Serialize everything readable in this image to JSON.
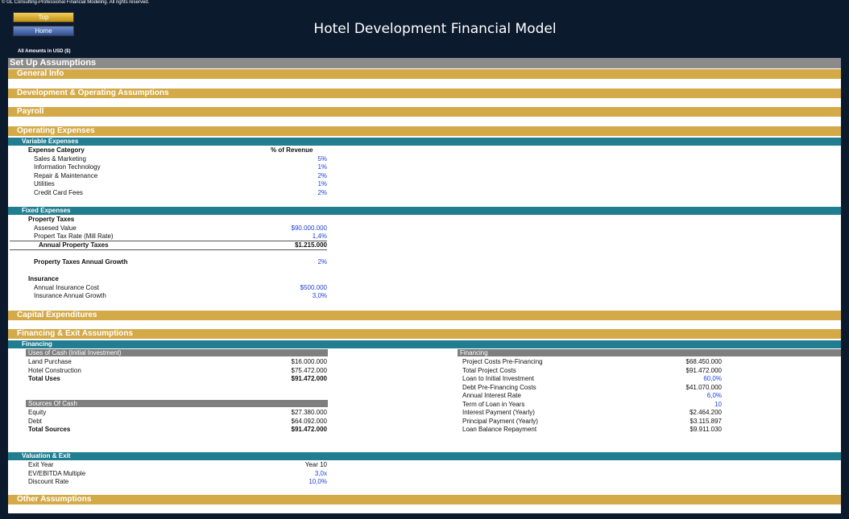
{
  "header": {
    "copyright": "© GL Consulting-Professional Financial Modeling. All rights reserved.",
    "top_button": "Top",
    "home_button": "Home",
    "title": "Hotel Development Financial Model",
    "currency_note": "All Amounts in  USD ($)"
  },
  "sections": {
    "setup": "Set Up Assumptions",
    "general_info": "General Info",
    "dev_operating": "Development & Operating Assumptions",
    "payroll": "Payroll",
    "operating_expenses": "Operating Expenses",
    "capital_expenditures": "Capital Expenditures",
    "financing_exit": "Financing & Exit Assumptions",
    "other": "Other Assumptions"
  },
  "variable_expenses": {
    "title": "Variable Expenses",
    "col_category": "Expense Category",
    "col_pct": "% of Revenue",
    "items": [
      {
        "label": "Sales & Marketing",
        "value": "5%"
      },
      {
        "label": "Information Technology",
        "value": "1%"
      },
      {
        "label": "Repair & Maintenance",
        "value": "2%"
      },
      {
        "label": "Utilities",
        "value": "1%"
      },
      {
        "label": "Credit Card Fees",
        "value": "2%"
      }
    ]
  },
  "fixed_expenses": {
    "title": "Fixed Expenses",
    "property_taxes": "Property Taxes",
    "assessed_value_label": "Assesed Value",
    "assessed_value": "$90.000.000",
    "tax_rate_label": "Propert Tax Rate (Mill Rate)",
    "tax_rate": "1,4%",
    "annual_tax_label": "Annual Property Taxes",
    "annual_tax": "$1.215.000",
    "tax_growth_label": "Property Taxes Annual Growth",
    "tax_growth": "2%",
    "insurance": "Insurance",
    "insurance_cost_label": "Annual Insurance Cost",
    "insurance_cost": "$500.000",
    "insurance_growth_label": "Insurance Annual Growth",
    "insurance_growth": "3,0%"
  },
  "financing": {
    "title": "Financing",
    "uses": {
      "header": "Uses of Cash (Initial Investment)",
      "rows": [
        {
          "label": "Land Purchase",
          "value": "$16.000.000",
          "bold": false
        },
        {
          "label": "Hotel Construction",
          "value": "$75.472.000",
          "bold": false
        },
        {
          "label": "Total Uses",
          "value": "$91.472.000",
          "bold": true
        }
      ]
    },
    "sources": {
      "header": "Sources Of Cash",
      "rows": [
        {
          "label": "Equity",
          "value": "$27.380.000",
          "bold": false
        },
        {
          "label": "Debt",
          "value": "$64.092.000",
          "bold": false
        },
        {
          "label": "Total Sources",
          "value": "$91.472.000",
          "bold": true
        }
      ]
    },
    "right": {
      "header": "Financing",
      "rows": [
        {
          "label": "Project Costs Pre-Financing",
          "value": "$68.450.000",
          "blue": false
        },
        {
          "label": "Total Project Costs",
          "value": "$91.472.000",
          "blue": false
        },
        {
          "label": "Loan to Initial Investment",
          "value": "60,0%",
          "blue": true
        },
        {
          "label": "Debt Pre-Financing Costs",
          "value": "$41.070.000",
          "blue": false
        },
        {
          "label": "Annual Interest Rate",
          "value": "6,0%",
          "blue": true
        },
        {
          "label": "Term of Loan in Years",
          "value": "10",
          "blue": true
        },
        {
          "label": "Interest Payment (Yearly)",
          "value": "$2.464.200",
          "blue": false
        },
        {
          "label": "Principal Payment (Yearly)",
          "value": "$3.115.897",
          "blue": false
        },
        {
          "label": "Loan Balance Repayment",
          "value": "$9.911.030",
          "blue": false
        }
      ]
    }
  },
  "valuation": {
    "title": "Valuation & Exit",
    "rows": [
      {
        "label": "Exit Year",
        "value": "Year 10",
        "blue": false
      },
      {
        "label": "EV/EBITDA Multiple",
        "value": "3,0x",
        "blue": true
      },
      {
        "label": "Discount Rate",
        "value": "10,0%",
        "blue": true
      }
    ]
  }
}
